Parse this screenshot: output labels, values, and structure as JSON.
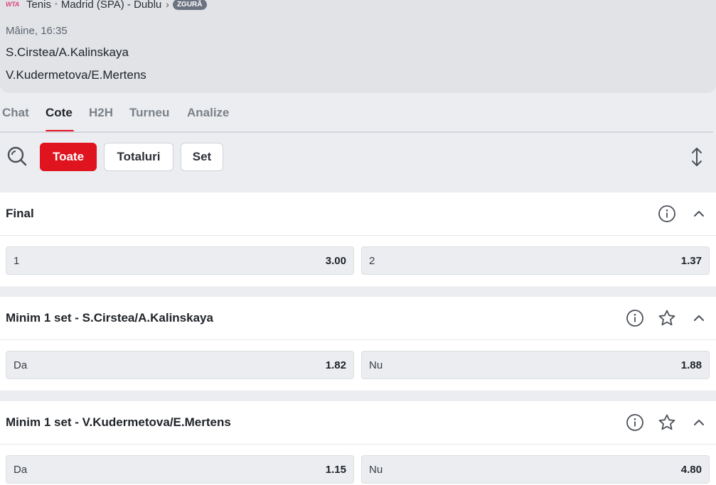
{
  "header": {
    "league_logo": "WTA",
    "breadcrumb": {
      "sport": "Tenis",
      "tournament": "Madrid (SPA) - Dublu",
      "surface_badge": "ZGURĂ"
    },
    "match_time": "Mâine, 16:35",
    "team1": "S.Cirstea/A.Kalinskaya",
    "team2": "V.Kudermetova/E.Mertens"
  },
  "tabs": [
    {
      "label": "Chat",
      "active": false
    },
    {
      "label": "Cote",
      "active": true
    },
    {
      "label": "H2H",
      "active": false
    },
    {
      "label": "Turneu",
      "active": false
    },
    {
      "label": "Analize",
      "active": false
    }
  ],
  "filters": [
    {
      "label": "Toate",
      "active": true
    },
    {
      "label": "Totaluri",
      "active": false
    },
    {
      "label": "Set",
      "active": false
    }
  ],
  "icons": {
    "search": "search-icon",
    "sort": "sort-vertical-icon",
    "info": "info-icon",
    "favorite": "star-icon",
    "collapse": "chevron-up-icon"
  },
  "colors": {
    "accent": "#e0141e",
    "header_bg": "#e1e3e7",
    "page_bg": "#ebedf0"
  },
  "markets": [
    {
      "title": "Final",
      "favorite": false,
      "outcomes": [
        {
          "label": "1",
          "odd": "3.00"
        },
        {
          "label": "2",
          "odd": "1.37"
        }
      ]
    },
    {
      "title": "Minim 1 set - S.Cirstea/A.Kalinskaya",
      "favorite": true,
      "outcomes": [
        {
          "label": "Da",
          "odd": "1.82"
        },
        {
          "label": "Nu",
          "odd": "1.88"
        }
      ]
    },
    {
      "title": "Minim 1 set - V.Kudermetova/E.Mertens",
      "favorite": true,
      "outcomes": [
        {
          "label": "Da",
          "odd": "1.15"
        },
        {
          "label": "Nu",
          "odd": "4.80"
        }
      ]
    }
  ]
}
